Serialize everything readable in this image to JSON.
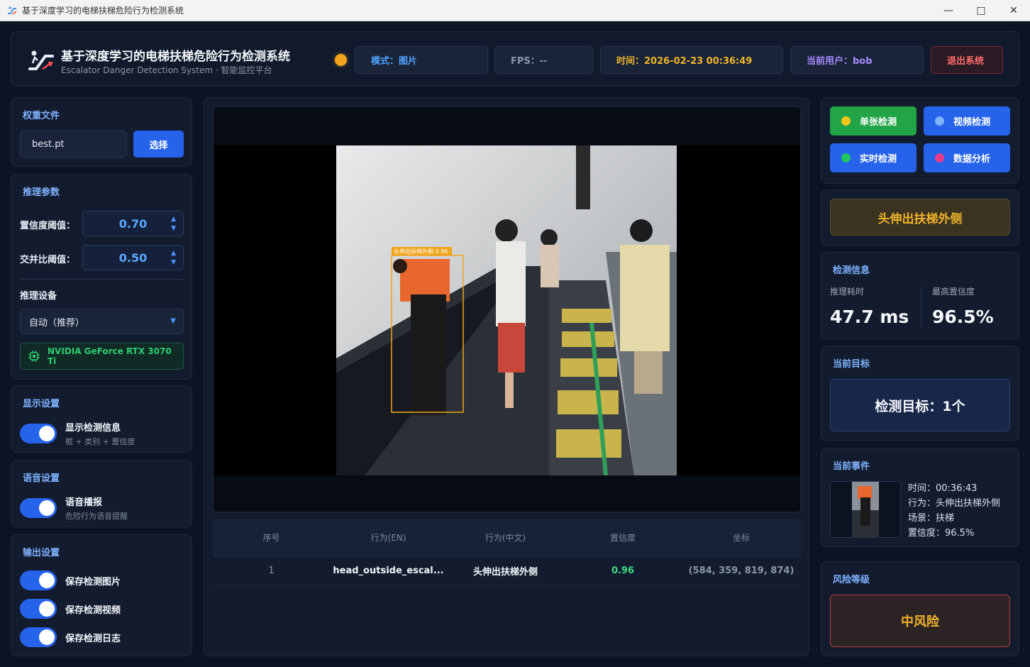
{
  "window": {
    "title": "基于深度学习的电梯扶梯危险行为检测系统"
  },
  "header": {
    "title": "基于深度学习的电梯扶梯危险行为检测系统",
    "subtitle": "Escalator Danger Detection System · 智能监控平台",
    "mode": "模式：图片",
    "fps": "FPS：--",
    "time": "时间：2026-02-23 00:36:49",
    "user": "当前用户：bob",
    "exit": "退出系统",
    "status_color": "#f0a51c"
  },
  "weights": {
    "title": "权重文件",
    "file": "best.pt",
    "select_label": "选择"
  },
  "inference": {
    "title": "推理参数",
    "conf_label": "置信度阈值：",
    "conf_value": "0.70",
    "iou_label": "交并比阈值：",
    "iou_value": "0.50",
    "device_title": "推理设备",
    "device_value": "自动（推荐）",
    "gpu": "NVIDIA GeForce RTX 3070 Ti"
  },
  "display": {
    "title": "显示设置",
    "toggle_label": "显示检测信息",
    "toggle_desc": "框 + 类别 + 置信度",
    "on": true
  },
  "voice": {
    "title": "语音设置",
    "toggle_label": "语音播报",
    "toggle_desc": "危险行为语音提醒",
    "on": true
  },
  "output": {
    "title": "输出设置",
    "items": [
      {
        "label": "保存检测图片",
        "on": true
      },
      {
        "label": "保存检测视频",
        "on": true
      },
      {
        "label": "保存检测日志",
        "on": true
      }
    ]
  },
  "viewer": {
    "box_label": "头伸出扶梯外侧 0.96"
  },
  "table": {
    "headers": [
      "序号",
      "行为(EN)",
      "行为(中文)",
      "置信度",
      "坐标"
    ],
    "rows": [
      {
        "idx": "1",
        "en": "head_outside_escal...",
        "cn": "头伸出扶梯外侧",
        "conf": "0.96",
        "coords": "(584, 359, 819, 874)"
      }
    ]
  },
  "modes": {
    "single": "单张检测",
    "video": "视频检测",
    "live": "实时检测",
    "data": "数据分析",
    "dot_colors": {
      "single": "#f5c518",
      "video": "#7fb2ff",
      "live": "#22c55e",
      "data": "#e83e8c"
    }
  },
  "alert": {
    "text": "头伸出扶梯外侧"
  },
  "info": {
    "title": "检测信息",
    "time_label": "推理耗时",
    "time_value": "47.7 ms",
    "conf_label": "最高置信度",
    "conf_value": "96.5%"
  },
  "target": {
    "title": "当前目标",
    "text": "检测目标：1个"
  },
  "event": {
    "title": "当前事件",
    "time": "时间：00:36:43",
    "behavior": "行为：头伸出扶梯外侧",
    "scene": "场景：扶梯",
    "conf": "置信度：96.5%"
  },
  "risk": {
    "title": "风险等级",
    "level": "中风险"
  }
}
